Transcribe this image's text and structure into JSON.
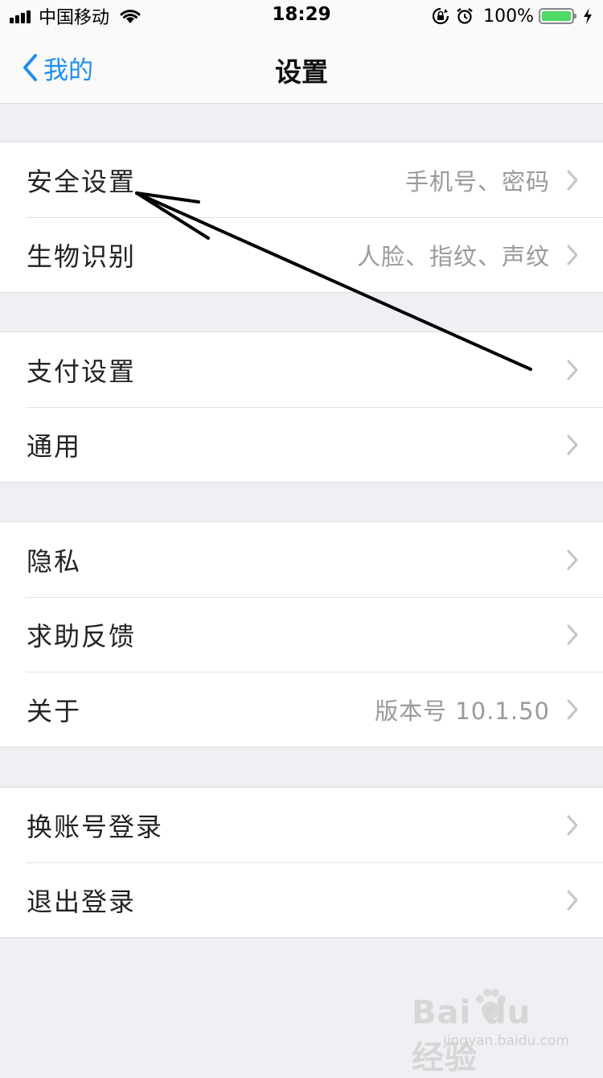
{
  "status_bar": {
    "carrier": "中国移动",
    "time": "18:29",
    "battery_percent": "100%"
  },
  "nav": {
    "back_label": "我的",
    "title": "设置"
  },
  "groups": [
    {
      "rows": [
        {
          "label": "安全设置",
          "detail": "手机号、密码"
        },
        {
          "label": "生物识别",
          "detail": "人脸、指纹、声纹"
        }
      ]
    },
    {
      "rows": [
        {
          "label": "支付设置",
          "detail": ""
        },
        {
          "label": "通用",
          "detail": ""
        }
      ]
    },
    {
      "rows": [
        {
          "label": "隐私",
          "detail": ""
        },
        {
          "label": "求助反馈",
          "detail": ""
        },
        {
          "label": "关于",
          "detail": "版本号 10.1.50"
        }
      ]
    },
    {
      "rows": [
        {
          "label": "换账号登录",
          "detail": ""
        },
        {
          "label": "退出登录",
          "detail": ""
        }
      ]
    }
  ],
  "watermark": {
    "logo": "Bai du 经验",
    "url": "jingyan.baidu.com"
  },
  "colors": {
    "accent": "#1e8ef0",
    "battery": "#4cd964",
    "background": "#efeff4"
  }
}
